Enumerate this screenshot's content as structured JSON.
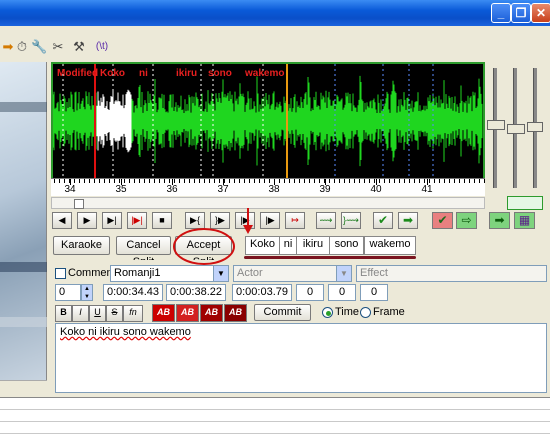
{
  "window": {
    "title_bar_color": "#0a4fc9",
    "buttons": [
      "_",
      "❐",
      "✕"
    ]
  },
  "toolbar": {
    "icons": [
      "arrow-icon",
      "timer-icon",
      "styles-icon",
      "tools-icon",
      "hammer-icon",
      "automation-icon"
    ],
    "glyphs": [
      "➡",
      "⏱",
      "🔧",
      "✂",
      "⚒",
      "(\\t)"
    ]
  },
  "audio": {
    "waveform_color": "#1fd61f",
    "selection_color": "#ffffff",
    "syllables": [
      "Modified",
      "Koko",
      "ni",
      "ikiru",
      "sono",
      "wakemo"
    ],
    "ruler": {
      "labels": [
        "34",
        "35",
        "36",
        "37",
        "38",
        "39",
        "40",
        "41"
      ]
    }
  },
  "transport": {
    "buttons": [
      "◀",
      "▶",
      "▶|",
      "|▶|",
      "■",
      "▶{",
      "}▶",
      "|▶",
      "|▶",
      "↦",
      "⟿",
      "}⟿",
      "✔",
      "➡",
      "✔",
      "⇨",
      "➡",
      "▦"
    ]
  },
  "karaoke": {
    "karaoke_label": "Karaoke",
    "cancel_split_label": "Cancel Split",
    "accept_split_label": "Accept Split",
    "syllables": [
      "Koko",
      "ni",
      "ikiru",
      "sono",
      "wakemo"
    ]
  },
  "edit": {
    "comment_label": "Comment",
    "style_value": "Romanji1",
    "actor_placeholder": "Actor",
    "effect_placeholder": "Effect",
    "layer_value": "0",
    "start_time": "0:00:34.43",
    "end_time": "0:00:38.22",
    "duration": "0:00:03.79",
    "margin_left": "0",
    "margin_right": "0",
    "margin_vertical": "0",
    "format_buttons": [
      "B",
      "I",
      "U",
      "S",
      "fn"
    ],
    "color_buttons": [
      "AB",
      "AB",
      "AB",
      "AB"
    ],
    "commit_label": "Commit",
    "time_label": "Time",
    "frame_label": "Frame",
    "text_value": "Koko ni ikiru sono wakemo"
  }
}
